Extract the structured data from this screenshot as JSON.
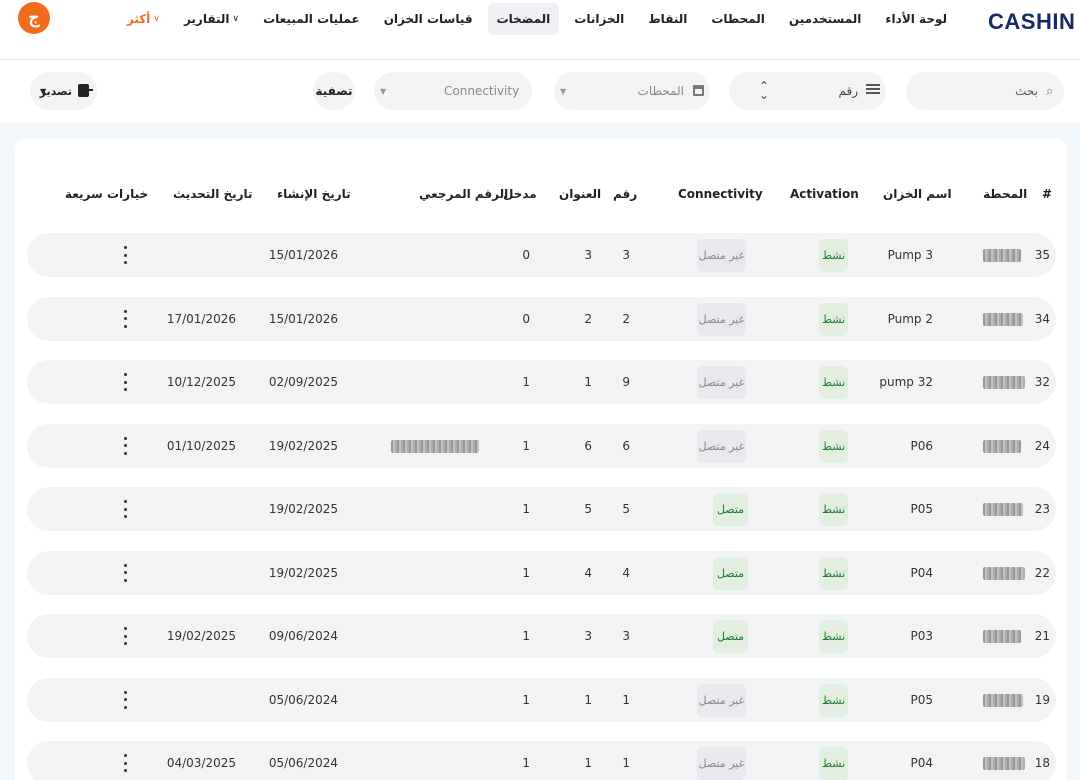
{
  "brand": "CASHIN",
  "avatar_initial": "ج",
  "nav": [
    {
      "label": "لوحة الأداء",
      "active": false
    },
    {
      "label": "المستخدمين",
      "active": false
    },
    {
      "label": "المحطات",
      "active": false
    },
    {
      "label": "النقاط",
      "active": false
    },
    {
      "label": "الخزانات",
      "active": false
    },
    {
      "label": "المضخات",
      "active": true
    },
    {
      "label": "قياسات الخزان",
      "active": false
    },
    {
      "label": "عمليات المبيعات",
      "active": false
    },
    {
      "label": "التقارير",
      "active": false,
      "dropdown": true
    },
    {
      "label": "أكثر",
      "active": false,
      "dropdown": true,
      "accent": "#f26b1d"
    }
  ],
  "filters": {
    "search_label": "بحث",
    "sort_label": "رقم",
    "station_placeholder": "المحطات",
    "connectivity_placeholder": "Connectivity",
    "filter_button": "تصفية",
    "export_button": "تصدير"
  },
  "table": {
    "headers": {
      "index": "#",
      "station": "المحطة",
      "tank_name": "اسم الخزان",
      "activation": "Activation",
      "connectivity": "Connectivity",
      "number": "رقم",
      "address": "العنوان",
      "input": "مدخل",
      "reference": "الرقم المرجعي",
      "created": "تاريخ الإنشاء",
      "updated": "تاريخ التحديث",
      "quick_actions": "خيارات سريعة"
    },
    "rows": [
      {
        "id": "35",
        "tank": "Pump 3",
        "activation": "نشط",
        "connectivity": "غير متصل",
        "connected": false,
        "number": "3",
        "address": "3",
        "input": "0",
        "reference": "",
        "created": "15/01/2026",
        "updated": ""
      },
      {
        "id": "34",
        "tank": "Pump 2",
        "activation": "نشط",
        "connectivity": "غير متصل",
        "connected": false,
        "number": "2",
        "address": "2",
        "input": "0",
        "reference": "",
        "created": "15/01/2026",
        "updated": "17/01/2026"
      },
      {
        "id": "32",
        "tank": "pump 32",
        "activation": "نشط",
        "connectivity": "غير متصل",
        "connected": false,
        "number": "9",
        "address": "1",
        "input": "1",
        "reference": "",
        "created": "02/09/2025",
        "updated": "10/12/2025"
      },
      {
        "id": "24",
        "tank": "P06",
        "activation": "نشط",
        "connectivity": "غير متصل",
        "connected": false,
        "number": "6",
        "address": "6",
        "input": "1",
        "reference": "redacted",
        "created": "19/02/2025",
        "updated": "01/10/2025"
      },
      {
        "id": "23",
        "tank": "P05",
        "activation": "نشط",
        "connectivity": "متصل",
        "connected": true,
        "number": "5",
        "address": "5",
        "input": "1",
        "reference": "",
        "created": "19/02/2025",
        "updated": ""
      },
      {
        "id": "22",
        "tank": "P04",
        "activation": "نشط",
        "connectivity": "متصل",
        "connected": true,
        "number": "4",
        "address": "4",
        "input": "1",
        "reference": "",
        "created": "19/02/2025",
        "updated": ""
      },
      {
        "id": "21",
        "tank": "P03",
        "activation": "نشط",
        "connectivity": "متصل",
        "connected": true,
        "number": "3",
        "address": "3",
        "input": "1",
        "reference": "",
        "created": "09/06/2024",
        "updated": "19/02/2025"
      },
      {
        "id": "19",
        "tank": "P05",
        "activation": "نشط",
        "connectivity": "غير متصل",
        "connected": false,
        "number": "1",
        "address": "1",
        "input": "1",
        "reference": "",
        "created": "05/06/2024",
        "updated": ""
      },
      {
        "id": "18",
        "tank": "P04",
        "activation": "نشط",
        "connectivity": "غير متصل",
        "connected": false,
        "number": "1",
        "address": "1",
        "input": "1",
        "reference": "",
        "created": "05/06/2024",
        "updated": "04/03/2025"
      }
    ]
  },
  "colors": {
    "brand": "#162a68",
    "accent": "#f26b1d",
    "active_green": "#1d7a2e"
  }
}
